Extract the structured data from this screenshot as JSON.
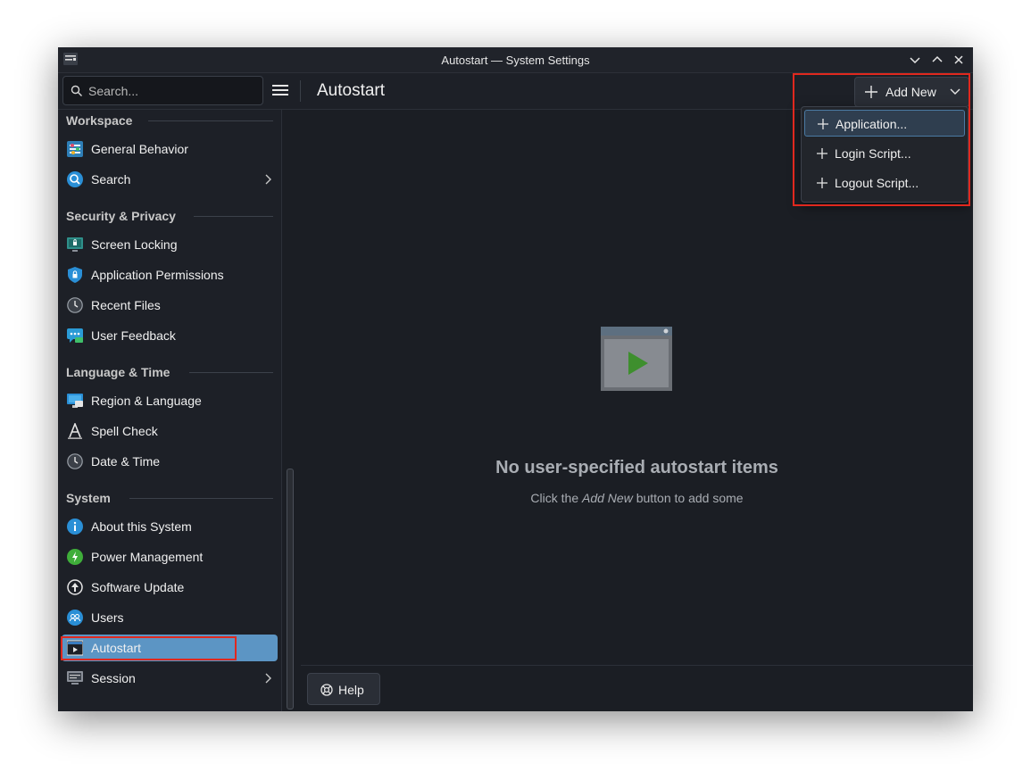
{
  "window": {
    "title": "Autostart — System Settings"
  },
  "toolbar": {
    "search_placeholder": "Search...",
    "page_title": "Autostart",
    "add_new_label": "Add New"
  },
  "sidebar": {
    "sections": [
      {
        "title": "Workspace",
        "items": [
          {
            "label": "General Behavior",
            "icon": "general-behavior-icon"
          },
          {
            "label": "Search",
            "icon": "search-icon",
            "has_submenu": true
          }
        ]
      },
      {
        "title": "Security & Privacy",
        "items": [
          {
            "label": "Screen Locking",
            "icon": "screen-lock-icon"
          },
          {
            "label": "Application Permissions",
            "icon": "shield-icon"
          },
          {
            "label": "Recent Files",
            "icon": "clock-icon"
          },
          {
            "label": "User Feedback",
            "icon": "feedback-icon"
          }
        ]
      },
      {
        "title": "Language & Time",
        "items": [
          {
            "label": "Region & Language",
            "icon": "region-icon"
          },
          {
            "label": "Spell Check",
            "icon": "spell-check-icon"
          },
          {
            "label": "Date & Time",
            "icon": "clock-icon"
          }
        ]
      },
      {
        "title": "System",
        "items": [
          {
            "label": "About this System",
            "icon": "info-icon"
          },
          {
            "label": "Power Management",
            "icon": "power-icon"
          },
          {
            "label": "Software Update",
            "icon": "update-icon"
          },
          {
            "label": "Users",
            "icon": "users-icon"
          },
          {
            "label": "Autostart",
            "icon": "autostart-icon",
            "active": true
          },
          {
            "label": "Session",
            "icon": "session-icon",
            "has_submenu": true
          }
        ]
      }
    ]
  },
  "content": {
    "empty_title": "No user-specified autostart items",
    "empty_sub_prefix": "Click the ",
    "empty_sub_emph": "Add New",
    "empty_sub_suffix": " button to add some"
  },
  "menu": {
    "items": [
      {
        "label": "Application...",
        "highlighted": true
      },
      {
        "label": "Login Script..."
      },
      {
        "label": "Logout Script..."
      }
    ]
  },
  "footer": {
    "help_label": "Help"
  },
  "colors": {
    "window_bg": "#1b1e24",
    "accent": "#5c95c4",
    "annotation": "#e0281e",
    "play_green": "#3e8f2e"
  }
}
